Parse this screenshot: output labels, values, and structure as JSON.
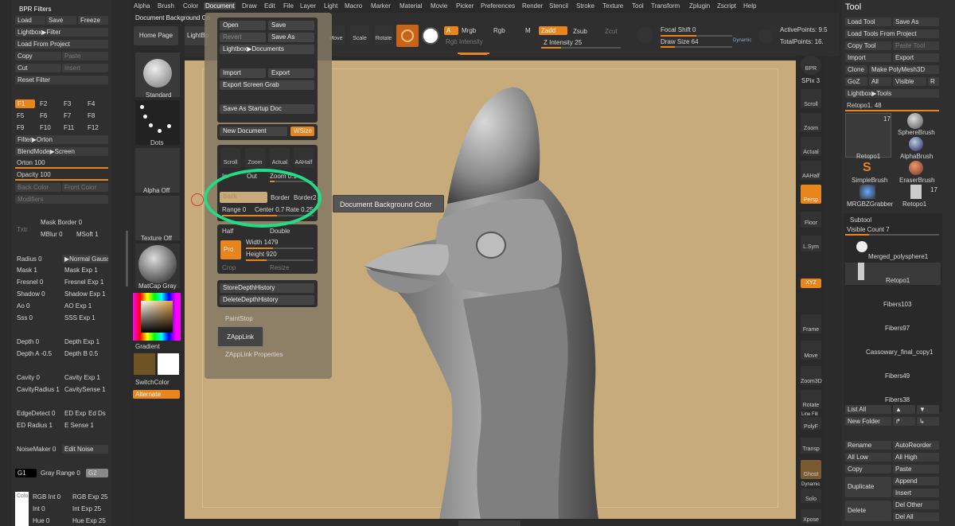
{
  "menubar": {
    "items": [
      "Alpha",
      "Brush",
      "Color",
      "Document",
      "Draw",
      "Edit",
      "File",
      "Layer",
      "Light",
      "Macro",
      "Marker",
      "Material",
      "Movie",
      "Picker",
      "Preferences",
      "Render",
      "Stencil",
      "Stroke",
      "Texture",
      "Tool",
      "Transform",
      "Zplugin",
      "Zscript",
      "Help"
    ]
  },
  "left": {
    "header": "BPR Filters",
    "load": "Load",
    "save": "Save",
    "freeze": "Freeze",
    "lightbox_filter": "Lightbox▶Filter",
    "load_from_project": "Load From Project",
    "copy": "Copy",
    "paste": "Paste",
    "cut": "Cut",
    "insert": "Insert",
    "reset_filter": "Reset Filter",
    "f_keys": [
      "F1",
      "F2",
      "F3",
      "F4",
      "F5",
      "F6",
      "F7",
      "F8",
      "F9",
      "F10",
      "F11",
      "F12"
    ],
    "filter_orton": "Filter▶Orton",
    "blendmode_screen": "BlendMode▶Screen",
    "orton": "Orton 100",
    "opacity": "Opacity 100",
    "back_color": "Back Color",
    "front_color": "Front Color",
    "modifiers": "Modifiers",
    "txtr": "Txtr",
    "mask_border": "Mask Border 0",
    "mblur": "MBlur 0",
    "msoft": "MSoft 1",
    "radius": "Radius 0",
    "normal_gauss": "▶Normal Gauss",
    "mask": "Mask 1",
    "mask_exp": "Mask Exp 1",
    "fresnel": "Fresnel 0",
    "fresnel_exp": "Fresnel Exp 1",
    "shadow": "Shadow 0",
    "shadow_exp": "Shadow Exp 1",
    "ao": "Ao 0",
    "ao_exp": "AO Exp 1",
    "sss": "Sss 0",
    "sss_exp": "SSS Exp 1",
    "depth": "Depth 0",
    "depth_exp": "Depth Exp 1",
    "depth_a": "Depth A -0.5",
    "depth_b": "Depth B 0.5",
    "cavity": "Cavity 0",
    "cavity_exp": "Cavity Exp 1",
    "cavity_radius": "CavityRadius 1",
    "cavity_sense": "CavitySense 1",
    "edge_detect": "EdgeDetect 0",
    "ed_exp": "ED Exp",
    "ed_ds": "Ed Ds",
    "ed_radius": "ED Radius 1",
    "e_sense": "E Sense 1",
    "noise_maker": "NoiseMaker 0",
    "edit_noise": "Edit Noise",
    "g1": "G1",
    "gray_range": "Gray Range 0",
    "g2": "G2",
    "rgb_int": "RGB Int 0",
    "rgb_exp": "RGB Exp 25",
    "int": "Int 0",
    "int_exp": "Int Exp 25",
    "hue": "Hue 0",
    "hue_exp": "Hue Exp 25",
    "colo": "Colo"
  },
  "shelf": {
    "standard": "Standard",
    "dots": "Dots",
    "alpha_off": "Alpha Off",
    "texture_off": "Texture Off",
    "matcap": "MatCap Gray",
    "gradient": "Gradient",
    "switch_color": "SwitchColor",
    "alternate": "Alternate"
  },
  "topbar": {
    "doc_bg_color": "Document Background Co",
    "home_page": "Home Page",
    "lightbox": "LightBox",
    "move": "Move",
    "scale": "Scale",
    "rotate": "Rotate",
    "a": "A",
    "mrgb": "Mrgb",
    "rgb": "Rgb",
    "m": "M",
    "rgb_intensity": "Rgb Intensity",
    "zadd": "Zadd",
    "zsub": "Zsub",
    "zcut": "Zcut",
    "z_intensity": "Z Intensity 25",
    "focal_shift": "Focal Shift 0",
    "draw_size": "Draw Size 64",
    "dynamic": "Dynamic",
    "active_points": "ActivePoints: 9.5",
    "total_points": "TotalPoints: 16."
  },
  "popup": {
    "open": "Open",
    "save": "Save",
    "revert": "Revert",
    "save_as": "Save As",
    "lightbox_documents": "Lightbox▶Documents",
    "import": "Import",
    "export": "Export",
    "export_screen_grab": "Export Screen Grab",
    "save_as_startup": "Save As Startup Doc",
    "new_document": "New Document",
    "wsize": "WSize",
    "scroll": "Scroll",
    "zoom": "Zoom",
    "actual": "Actual",
    "aahalf": "AAHalf",
    "in": "In",
    "out": "Out",
    "zoom_val": "Zoom 0.1",
    "back": "Back",
    "border": "Border",
    "border2": "Border2",
    "range": "Range 0",
    "center": "Center 0.7",
    "rate": "Rate 0.25",
    "half": "Half",
    "double": "Double",
    "pro": "Pro",
    "width": "Width 1479",
    "height": "Height 920",
    "crop": "Crop",
    "resize": "Resize",
    "store_depth": "StoreDepthHistory",
    "delete_depth": "DeleteDepthHistory",
    "paintstop": "PaintStop",
    "zapplink": "ZAppLink",
    "zapplink_props": "ZAppLink Properties"
  },
  "tooltip": "Document Background Color",
  "rightshelf": {
    "bpr": "BPR",
    "spix": "SPix 3",
    "scroll": "Scroll",
    "zoom": "Zoom",
    "actual": "Actual",
    "aahalf": "AAHalf",
    "persp": "Persp",
    "floor": "Floor",
    "lsym": "L.Sym",
    "xyz": "XYZ",
    "frame": "Frame",
    "move": "Move",
    "zoom3d": "Zoom3D",
    "rotate": "Rotate",
    "line_fill": "Line Fill",
    "polyf": "PolyF",
    "transp": "Transp",
    "ghost": "Ghost",
    "dynamic": "Dynamic",
    "solo": "Solo",
    "xpose": "Xpose"
  },
  "tool": {
    "title": "Tool",
    "load_tool": "Load Tool",
    "save_as": "Save As",
    "load_from_project": "Load Tools From Project",
    "copy_tool": "Copy Tool",
    "paste_tool": "Paste Tool",
    "import": "Import",
    "export": "Export",
    "clone": "Clone",
    "make_polymesh": "Make PolyMesh3D",
    "goz": "GoZ",
    "all": "All",
    "visible": "Visible",
    "r": "R",
    "lightbox_tools": "Lightbox▶Tools",
    "retopo_slider": "Retopo1. 48",
    "thumbs": [
      {
        "name": "Retopo1",
        "count": "17"
      },
      {
        "name": "SphereBrush",
        "count": ""
      },
      {
        "name": "AlphaBrush",
        "count": ""
      },
      {
        "name": "SimpleBrush",
        "count": ""
      },
      {
        "name": "EraserBrush",
        "count": ""
      },
      {
        "name": "MRGBZGrabber",
        "count": ""
      },
      {
        "name": "Retopo1",
        "count": "17"
      }
    ],
    "subtool_header": "Subtool",
    "visible_count": "Visible Count 7",
    "subtools": [
      "Merged_polysphere1",
      "Retopo1",
      "Fibers103",
      "Fibers97",
      "Cassowary_final_copy1",
      "Fibers49",
      "Fibers38"
    ],
    "list_all": "List All",
    "new_folder": "New Folder",
    "rename": "Rename",
    "auto_reorder": "AutoReorder",
    "all_low": "All Low",
    "all_high": "All High",
    "copy": "Copy",
    "paste": "Paste",
    "duplicate": "Duplicate",
    "append": "Append",
    "insert": "Insert",
    "delete": "Delete",
    "del_other": "Del Other",
    "del_all": "Del All"
  },
  "colors": {
    "accent": "#e8851c",
    "canvas": "#c8ab7a",
    "highlight": "#22dd88"
  }
}
